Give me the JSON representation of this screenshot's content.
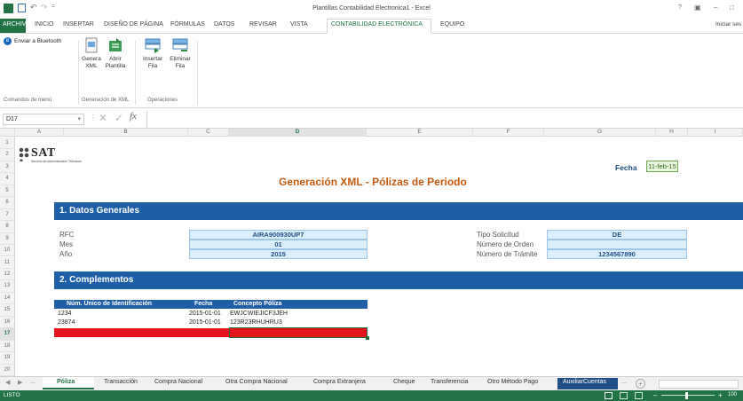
{
  "window": {
    "title": "Plantillas Contabilidad Electronica1 - Excel",
    "controls": [
      "?",
      "▣",
      "–",
      "□"
    ]
  },
  "ribbon_tabs": [
    {
      "label": "ARCHIVO",
      "active": false
    },
    {
      "label": "INICIO",
      "active": false
    },
    {
      "label": "INSERTAR",
      "active": false
    },
    {
      "label": "DISEÑO DE PÁGINA",
      "active": false
    },
    {
      "label": "FÓRMULAS",
      "active": false
    },
    {
      "label": "DATOS",
      "active": false
    },
    {
      "label": "REVISAR",
      "active": false
    },
    {
      "label": "VISTA",
      "active": false
    },
    {
      "label": "CONTABILIDAD ELECTRÓNICA",
      "active": true
    },
    {
      "label": "EQUIPO",
      "active": false
    }
  ],
  "signin": "Iniciar ses",
  "ribbon": {
    "bluetooth": "Enviar a Bluetooth",
    "buttons": [
      {
        "line1": "Genera",
        "line2": "XML"
      },
      {
        "line1": "Abrir",
        "line2": "Plantilla"
      },
      {
        "line1": "Insertar",
        "line2": "Fila"
      },
      {
        "line1": "Eliminar",
        "line2": "Fila"
      }
    ],
    "groups": [
      "Comandos de menú",
      "Generación de XML",
      "Operaciones"
    ]
  },
  "formula": {
    "namebox": "D17",
    "fx": "fx",
    "content": ""
  },
  "columns": [
    "A",
    "B",
    "C",
    "D",
    "E",
    "F",
    "G",
    "H",
    "I"
  ],
  "rows": [
    "1",
    "2",
    "3",
    "4",
    "5",
    "6",
    "7",
    "8",
    "9",
    "10",
    "11",
    "12",
    "13",
    "14",
    "15",
    "16",
    "17",
    "18",
    "19",
    "20"
  ],
  "sheet": {
    "logo": {
      "text": "SAT",
      "sub": "Servicio de Administración Tributaria"
    },
    "title": "Generación XML - Pólizas de Periodo",
    "fecha_label": "Fecha",
    "fecha_value": "11-feb-15",
    "section1": "1. Datos Generales",
    "section2": "2. Complementos",
    "left_fields": [
      {
        "label": "RFC",
        "value": "AIRA900930UP7"
      },
      {
        "label": "Mes",
        "value": "01"
      },
      {
        "label": "Año",
        "value": "2015"
      }
    ],
    "right_fields": [
      {
        "label": "Tipo Solicitud",
        "value": "DE"
      },
      {
        "label": "Número de Orden",
        "value": ""
      },
      {
        "label": "Número de Trámite",
        "value": "1234567890"
      }
    ],
    "table": {
      "headers": [
        "Núm. Único de Identificación",
        "Fecha",
        "Concepto Póliza"
      ],
      "rows": [
        [
          "1234",
          "2015-01-01",
          "EWJCWIEJICF3JEH"
        ],
        [
          "23874",
          "2015-01-01",
          "123R23RHUHRU3"
        ]
      ]
    }
  },
  "sheet_tabs": [
    {
      "label": "Póliza",
      "active": true
    },
    {
      "label": "Transacción",
      "active": false
    },
    {
      "label": "Compra Nacional",
      "active": false
    },
    {
      "label": "Otra Compra Nacional",
      "active": false
    },
    {
      "label": "Compra Extranjera",
      "active": false
    },
    {
      "label": "Cheque",
      "active": false
    },
    {
      "label": "Transferencia",
      "active": false
    },
    {
      "label": "Otro Método Pago",
      "active": false
    },
    {
      "label": "AuxiliarCuentas",
      "active": false,
      "highlight": true
    }
  ],
  "status": {
    "left": "LISTO",
    "zoom": "100"
  },
  "colors": {
    "accent": "#217346",
    "section_blue": "#1f5fa8",
    "title_orange": "#c55a11",
    "error_red": "#e3141b"
  }
}
